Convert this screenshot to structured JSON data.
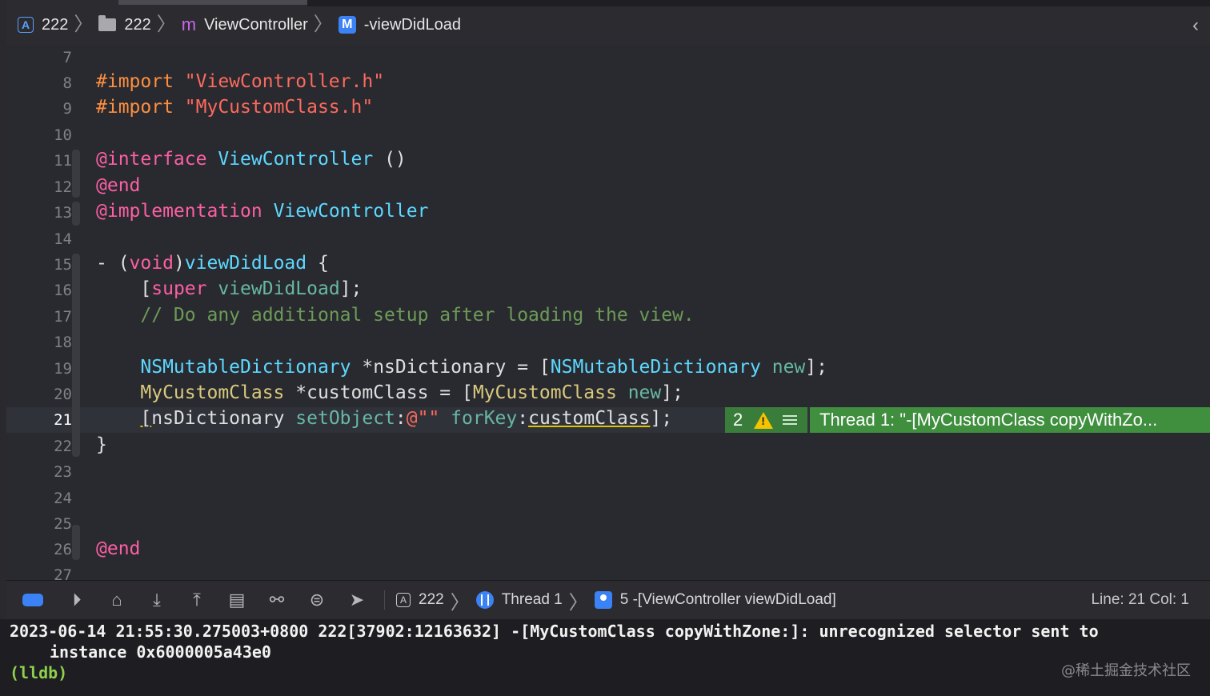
{
  "breadcrumb": {
    "project": "222",
    "group": "222",
    "file_icon_letter": "m",
    "file": "ViewController",
    "method_icon_letter": "M",
    "method": "-viewDidLoad"
  },
  "editor": {
    "line_numbers": [
      "7",
      "8",
      "9",
      "10",
      "11",
      "12",
      "13",
      "14",
      "15",
      "16",
      "17",
      "18",
      "19",
      "20",
      "21",
      "22",
      "23",
      "24",
      "25",
      "26",
      "27"
    ],
    "current_line": "21",
    "code": {
      "l8a": "#import",
      "l8b": "\"ViewController.h\"",
      "l9a": "#import",
      "l9b": "\"MyCustomClass.h\"",
      "l11a": "@interface",
      "l11b": "ViewController",
      "l11c": "()",
      "l12": "@end",
      "l13a": "@implementation",
      "l13b": "ViewController",
      "l15a": "- (",
      "l15b": "void",
      "l15c": ")",
      "l15d": "viewDidLoad",
      "l15e": " {",
      "l16a": "[",
      "l16b": "super",
      "l16c": "viewDidLoad",
      "l16d": "];",
      "l17": "// Do any additional setup after loading the view.",
      "l19a": "NSMutableDictionary",
      "l19b": " *nsDictionary = [",
      "l19c": "NSMutableDictionary",
      "l19d": "new",
      "l19e": "];",
      "l20a": "MyCustomClass",
      "l20b": " *customClass = [",
      "l20c": "MyCustomClass",
      "l20d": "new",
      "l20e": "];",
      "l21a": "[",
      "l21b": "nsDictionary",
      "l21c": "setObject",
      "l21d": ":",
      "l21e": "@\"\"",
      "l21f": "forKey",
      "l21g": ":",
      "l21h": "customClass",
      "l21i": "];",
      "l22": "}",
      "l26": "@end"
    },
    "issue_count": "2",
    "thread_message": "Thread 1: \"-[MyCustomClass copyWithZo..."
  },
  "debugbar": {
    "app": "222",
    "thread": "Thread 1",
    "frame": "5 -[ViewController viewDidLoad]",
    "line_col": "Line: 21  Col: 1"
  },
  "console": {
    "line1": "2023-06-14 21:55:30.275003+0800 222[37902:12163632] -[MyCustomClass copyWithZone:]: unrecognized selector sent to",
    "line2": "instance 0x6000005a43e0",
    "prompt": "(lldb)",
    "watermark": "@稀土掘金技术社区"
  },
  "colors": {
    "keyword": "#fc5fa3",
    "preprocessor": "#fd8f3f",
    "string": "#fc6a5d",
    "comment": "#6c9a57",
    "type": "#5dd8ff",
    "thread_banner": "#3f8f3f",
    "accent": "#3b82f6"
  },
  "icons": [
    "app-icon",
    "folder-icon",
    "objc-file-icon",
    "method-icon",
    "back-arrow-icon",
    "warning-icon",
    "breakpoint-toggle-icon",
    "continue-icon",
    "step-over-icon",
    "step-into-icon",
    "step-out-icon",
    "view-hierarchy-icon",
    "memory-graph-icon",
    "environment-icon",
    "location-icon",
    "thread-icon",
    "frame-icon"
  ]
}
